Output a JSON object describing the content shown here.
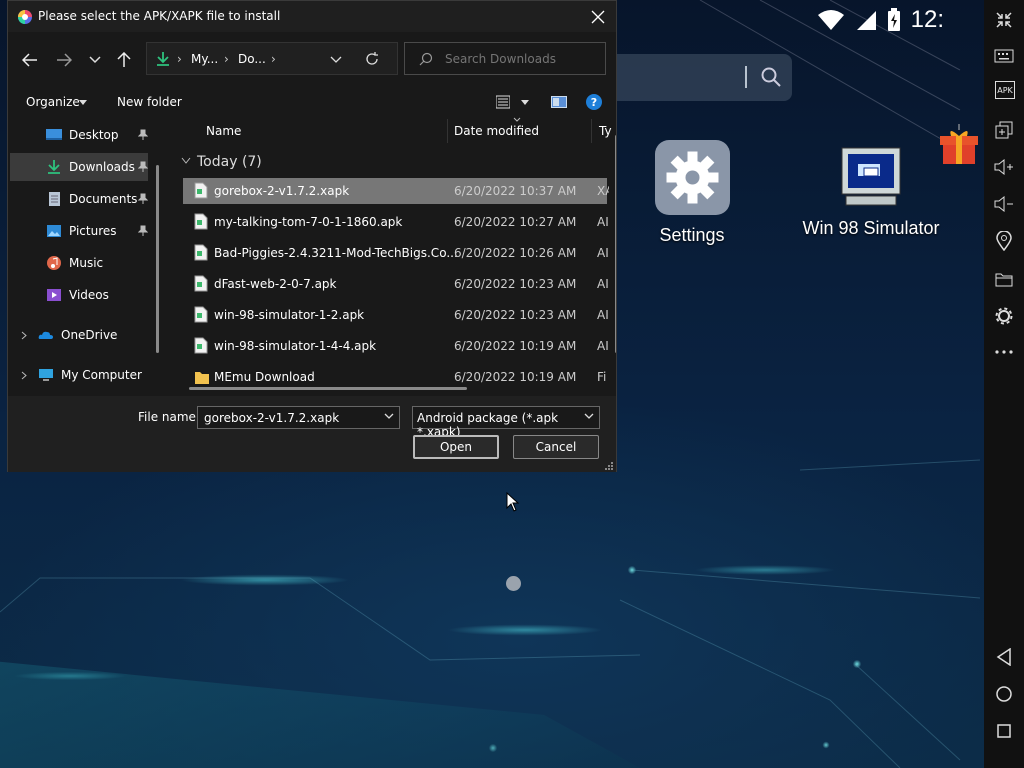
{
  "dialog": {
    "title": "Please select the APK/XAPK file to install",
    "nav": {
      "breadcrumb": [
        "My...",
        "Do..."
      ],
      "search_placeholder": "Search Downloads"
    },
    "commands": {
      "organize": "Organize",
      "new_folder": "New folder"
    },
    "sidebar": [
      {
        "label": "Desktop",
        "icon": "desktop-icon",
        "pinned": true
      },
      {
        "label": "Downloads",
        "icon": "downloads-icon",
        "pinned": true,
        "selected": true
      },
      {
        "label": "Documents",
        "icon": "documents-icon",
        "pinned": true
      },
      {
        "label": "Pictures",
        "icon": "pictures-icon",
        "pinned": true
      },
      {
        "label": "Music",
        "icon": "music-icon",
        "pinned": false
      },
      {
        "label": "Videos",
        "icon": "videos-icon",
        "pinned": false
      },
      {
        "label": "OneDrive",
        "icon": "onedrive-icon",
        "expandable": true
      },
      {
        "label": "My Computer",
        "icon": "computer-icon",
        "expandable": true
      }
    ],
    "columns": {
      "name": "Name",
      "date": "Date modified",
      "type": "Ty"
    },
    "group": "Today (7)",
    "files": [
      {
        "name": "gorebox-2-v1.7.2.xapk",
        "date": "6/20/2022 10:37 AM",
        "type": "XA",
        "kind": "file",
        "selected": true
      },
      {
        "name": "my-talking-tom-7-0-1-1860.apk",
        "date": "6/20/2022 10:27 AM",
        "type": "AI",
        "kind": "file"
      },
      {
        "name": "Bad-Piggies-2.4.3211-Mod-TechBigs.Co...",
        "date": "6/20/2022 10:26 AM",
        "type": "AI",
        "kind": "file"
      },
      {
        "name": "dFast-web-2-0-7.apk",
        "date": "6/20/2022 10:23 AM",
        "type": "AI",
        "kind": "file"
      },
      {
        "name": "win-98-simulator-1-2.apk",
        "date": "6/20/2022 10:23 AM",
        "type": "AI",
        "kind": "file"
      },
      {
        "name": "win-98-simulator-1-4-4.apk",
        "date": "6/20/2022 10:19 AM",
        "type": "AI",
        "kind": "file"
      },
      {
        "name": "MEmu Download",
        "date": "6/20/2022 10:19 AM",
        "type": "Fi",
        "kind": "folder"
      }
    ],
    "footer": {
      "file_name_label": "File name:",
      "file_name_value": "gorebox-2-v1.7.2.xapk",
      "file_type": "Android package (*.apk *.xapk)",
      "open": "Open",
      "cancel": "Cancel"
    }
  },
  "android": {
    "time": "12:",
    "apps": [
      {
        "label": "Settings",
        "icon": "settings-gear-icon"
      },
      {
        "label": "Win 98 Simulator",
        "icon": "win98-computer-icon"
      }
    ]
  },
  "toolbar": {
    "items": [
      "fullscreen-icon",
      "keyboard-icon",
      "apk-icon",
      "multi-window-icon",
      "volume-up-icon",
      "volume-down-icon",
      "location-icon",
      "folder-icon",
      "settings-icon",
      "more-icon",
      "back-icon",
      "home-icon",
      "recents-icon"
    ],
    "apk_text": "APK"
  },
  "colors": {
    "dialog_bg": "#191919",
    "selection": "#777777",
    "accent": "#1e90ff"
  }
}
